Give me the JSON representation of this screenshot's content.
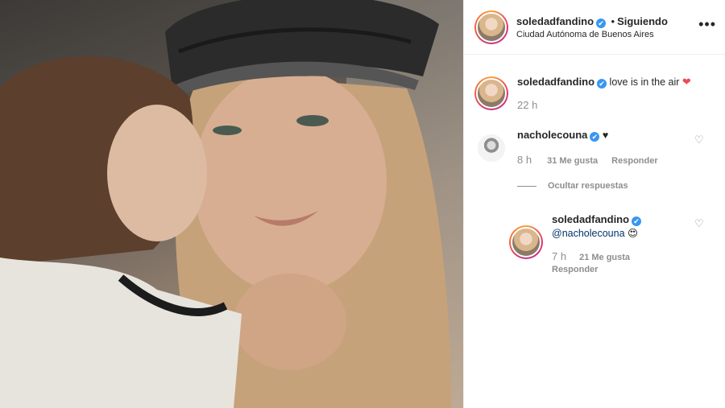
{
  "post": {
    "author": "soledadfandino",
    "dot": "•",
    "following": "Siguiendo",
    "location": "Ciudad Autónoma de Buenos Aires",
    "more": "•••"
  },
  "caption": {
    "username": "soledadfandino",
    "text": "love is in the air",
    "emoji": "❤",
    "time": "22 h"
  },
  "comments": [
    {
      "username": "nacholecouna",
      "text": "♥",
      "time": "8 h",
      "likes": "31 Me gusta",
      "reply": "Responder"
    }
  ],
  "hide_replies": "Ocultar respuestas",
  "reply": {
    "username": "soledadfandino",
    "mention": "@nacholecouna",
    "emoji": "😍",
    "time": "7 h",
    "likes": "21 Me gusta",
    "reply": "Responder"
  },
  "icons": {
    "verified": "verified-badge-icon",
    "like": "heart-outline-icon",
    "more": "more-options-icon"
  },
  "colors": {
    "verified_blue": "#3897f0",
    "heart_red": "#ed4956",
    "muted_gray": "#8e8e8e"
  }
}
